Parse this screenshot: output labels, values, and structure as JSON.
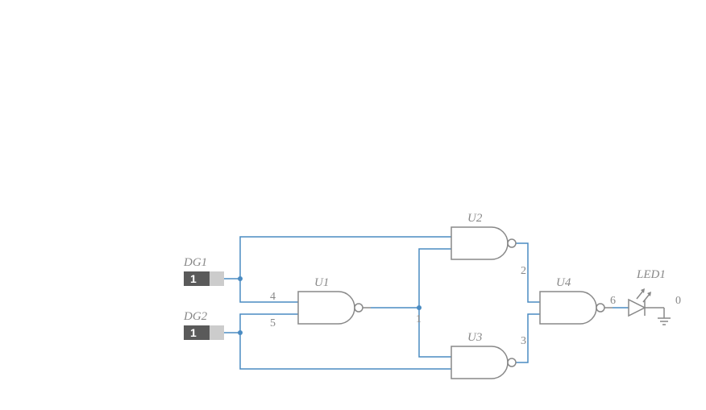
{
  "sources": {
    "dg1": {
      "label": "DG1",
      "value": "1"
    },
    "dg2": {
      "label": "DG2",
      "value": "1"
    }
  },
  "gates": {
    "u1": {
      "label": "U1"
    },
    "u2": {
      "label": "U2"
    },
    "u3": {
      "label": "U3"
    },
    "u4": {
      "label": "U4"
    }
  },
  "led": {
    "label": "LED1"
  },
  "pins": {
    "p1": "1",
    "p2": "2",
    "p3": "3",
    "p4": "4",
    "p5": "5",
    "p6": "6",
    "p0": "0"
  },
  "colors": {
    "wire": "#4a8bc2",
    "component": "#888888",
    "source_dark": "#5a5a5a",
    "source_light": "#cccccc"
  }
}
